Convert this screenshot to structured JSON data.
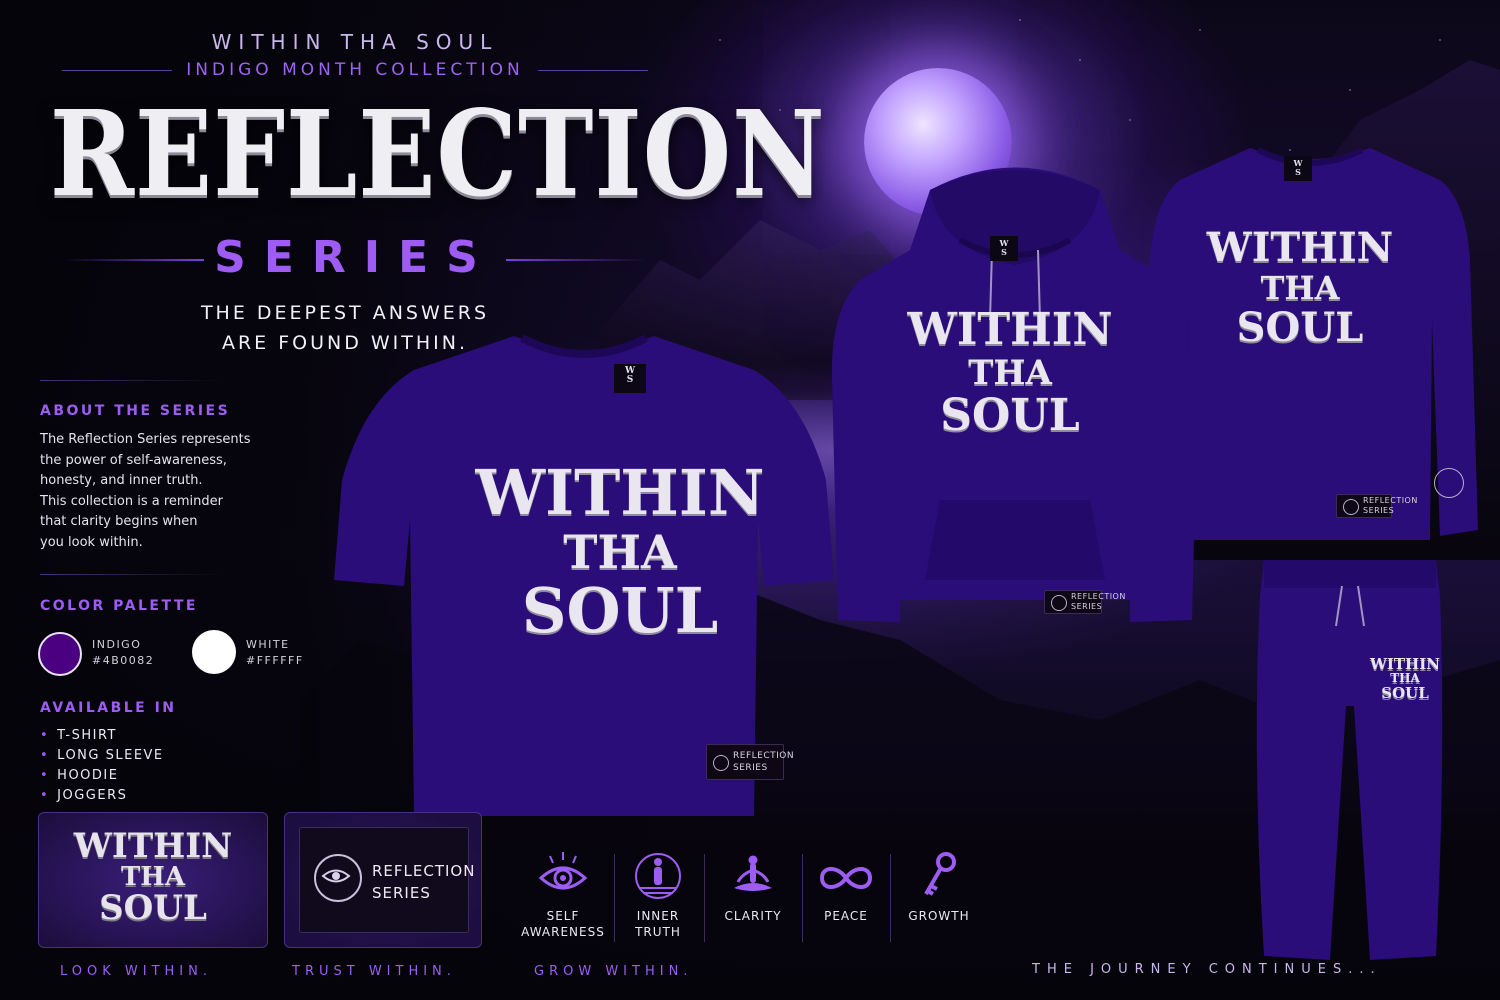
{
  "header": {
    "brand": "WITHIN THA SOUL",
    "collection": "INDIGO MONTH COLLECTION",
    "title": "REFLECTION",
    "subtitle": "SERIES",
    "tagline_line1": "THE DEEPEST ANSWERS",
    "tagline_line2": "ARE FOUND WITHIN."
  },
  "about": {
    "heading": "ABOUT THE SERIES",
    "body": "The Reflection Series represents\nthe power of self-awareness,\nhonesty, and inner truth.\nThis collection is a reminder\nthat clarity begins when\nyou look within."
  },
  "palette": {
    "heading": "COLOR PALETTE",
    "colors": [
      {
        "name": "INDIGO",
        "hex": "#4B0082",
        "swatch": "#4b0082"
      },
      {
        "name": "WHITE",
        "hex": "#FFFFFF",
        "swatch": "#ffffff"
      }
    ]
  },
  "available": {
    "heading": "AVAILABLE IN",
    "items": [
      "T-SHIRT",
      "LONG SLEEVE",
      "HOODIE",
      "JOGGERS"
    ]
  },
  "logo": {
    "line1": "WITHIN",
    "line2": "THA",
    "line3": "SOUL"
  },
  "patch_label": {
    "line1": "REFLECTION",
    "line2": "SERIES"
  },
  "values": [
    {
      "icon": "eye-icon",
      "line1": "SELF",
      "line2": "AWARENESS"
    },
    {
      "icon": "meditating-figure-icon",
      "line1": "INNER",
      "line2": "TRUTH"
    },
    {
      "icon": "lotus-pose-icon",
      "line1": "CLARITY",
      "line2": ""
    },
    {
      "icon": "infinity-icon",
      "line1": "PEACE",
      "line2": ""
    },
    {
      "icon": "key-icon",
      "line1": "GROWTH",
      "line2": ""
    }
  ],
  "footer": {
    "look": "LOOK WITHIN.",
    "trust": "TRUST WITHIN.",
    "grow": "GROW WITHIN.",
    "journey": "THE JOURNEY CONTINUES..."
  },
  "colors": {
    "accent": "#9d5cf2",
    "garment": "#2a0d78",
    "background": "#07050d"
  }
}
